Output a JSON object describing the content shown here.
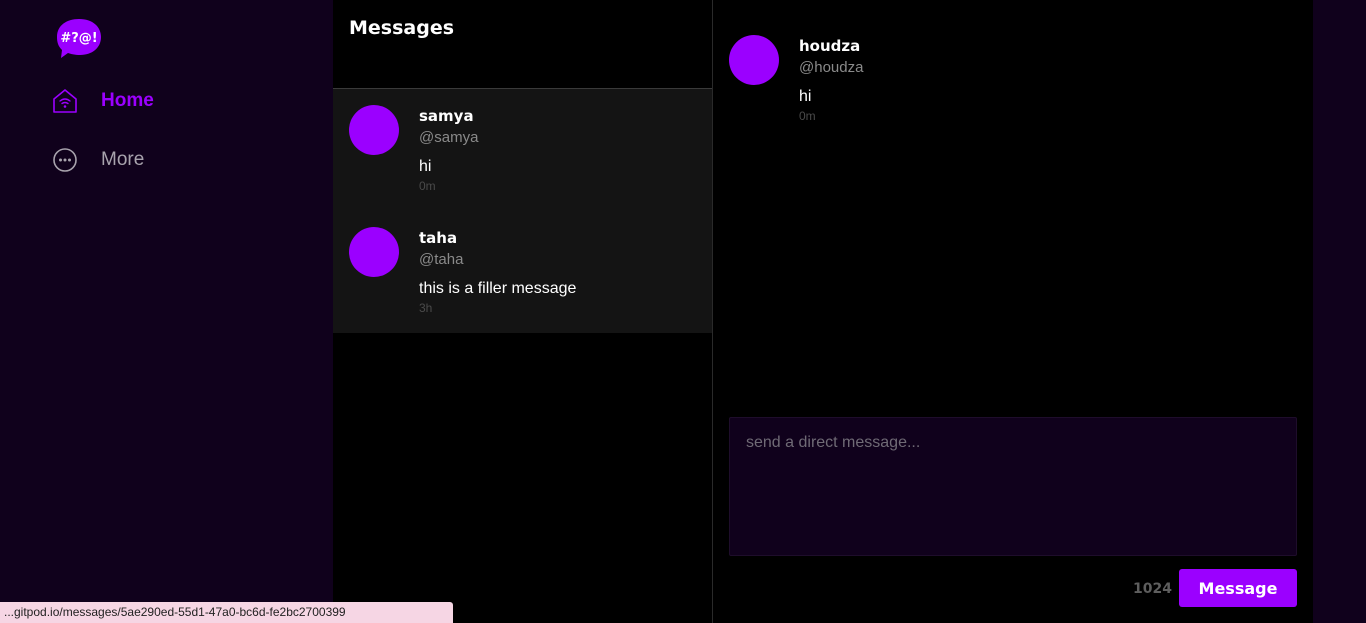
{
  "sidebar": {
    "logo_text": "#?@!",
    "items": [
      {
        "label": "Home",
        "icon": "home-wifi-icon",
        "active": true
      },
      {
        "label": "More",
        "icon": "more-dots-icon",
        "active": false
      }
    ]
  },
  "messages": {
    "title": "Messages",
    "conversations": [
      {
        "name": "samya",
        "handle": "@samya",
        "text": "hi",
        "time": "0m"
      },
      {
        "name": "taha",
        "handle": "@taha",
        "text": "this is a filler message",
        "time": "3h"
      }
    ]
  },
  "chat": {
    "message": {
      "name": "houdza",
      "handle": "@houdza",
      "text": "hi",
      "time": "0m"
    },
    "input_placeholder": "send a direct message...",
    "char_count": "1024",
    "send_label": "Message"
  },
  "status_bar": {
    "url": "...gitpod.io/messages/5ae290ed-55d1-47a0-bc6d-fe2bc2700399"
  },
  "colors": {
    "accent": "#9b00ff",
    "sidebar_bg": "#10011c",
    "list_bg": "#141414"
  }
}
